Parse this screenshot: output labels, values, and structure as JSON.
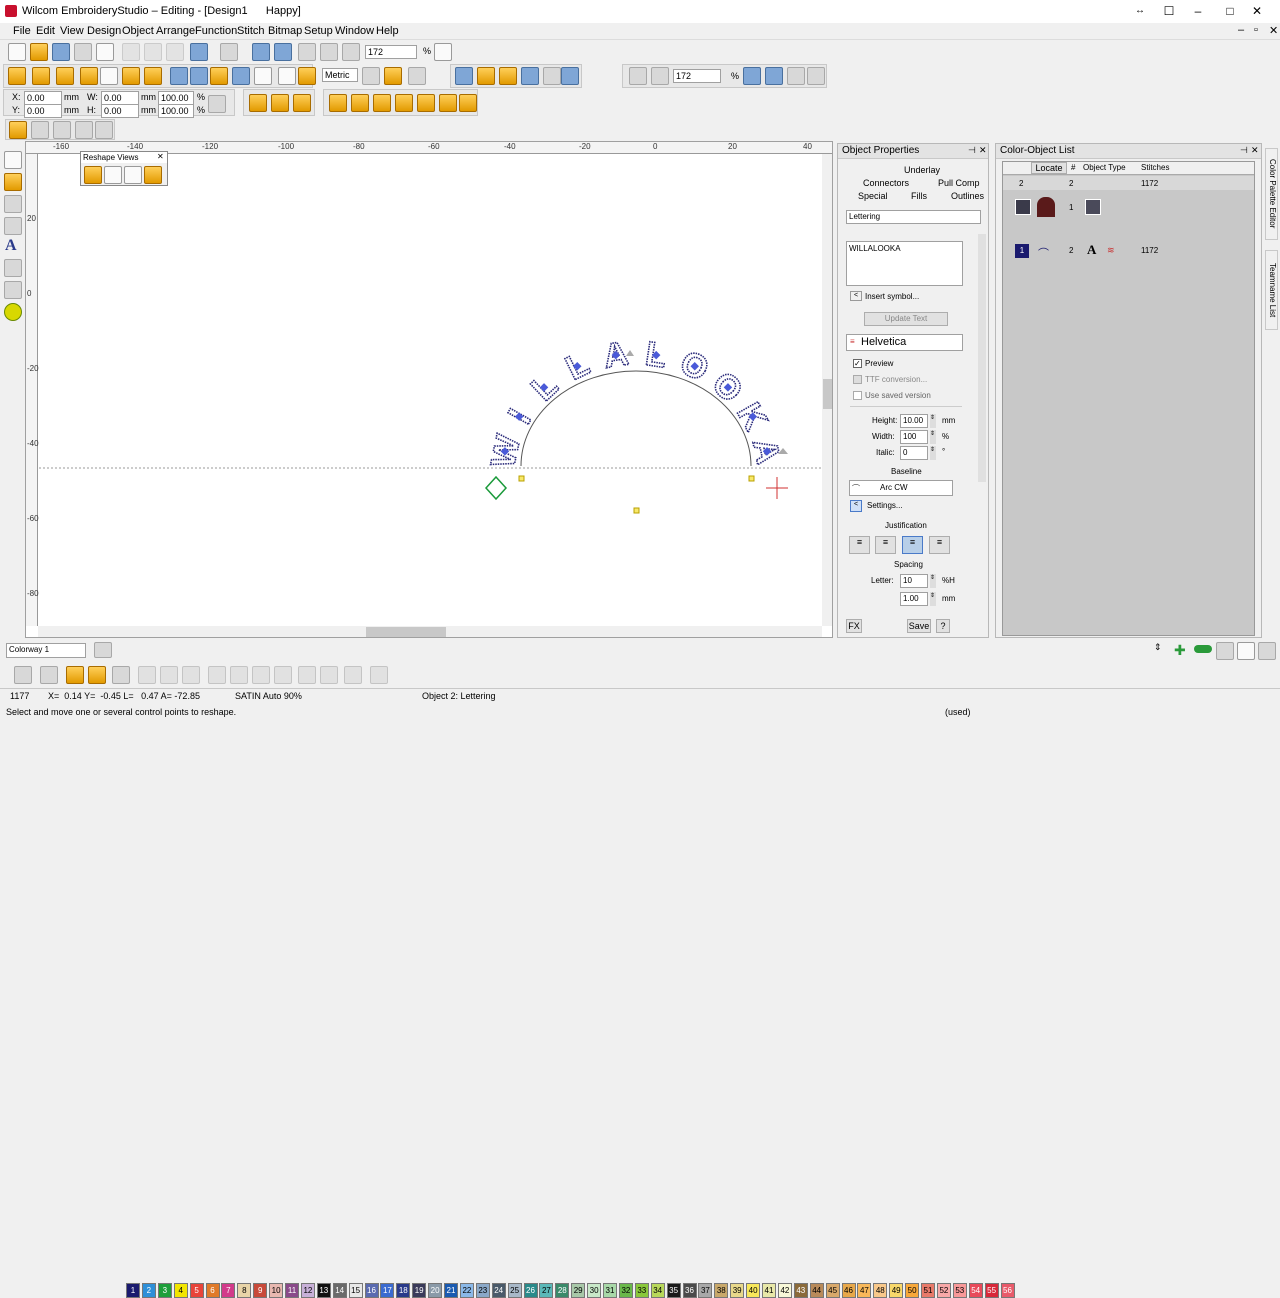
{
  "window": {
    "title": "Wilcom EmbroideryStudio – Editing - [Design1      Happy]",
    "controls": [
      "↔",
      "☐",
      "–",
      "□",
      "✕"
    ]
  },
  "menu": [
    "File",
    "Edit",
    "View",
    "Design",
    "Object",
    "Arrange",
    "Function",
    "Stitch",
    "Bitmap",
    "Setup",
    "Window",
    "Help"
  ],
  "toolbar": {
    "zoom_value": "172",
    "zoom_unit": "%",
    "units_select": "Metric",
    "zoom_value2": "172",
    "zoom_unit2": "%",
    "x_label": "X:",
    "x_value": "0.00",
    "x_unit": "mm",
    "y_label": "Y:",
    "y_value": "0.00",
    "y_unit": "mm",
    "w_label": "W:",
    "w_value": "0.00",
    "w_unit": "mm",
    "h_label": "H:",
    "h_value": "0.00",
    "h_unit": "mm",
    "w_pct": "100.00",
    "h_pct": "100.00",
    "pct": "%"
  },
  "reshape_views": {
    "title": "Reshape Views"
  },
  "ruler": {
    "top": [
      "-160",
      "-140",
      "-120",
      "-100",
      "-80",
      "-60",
      "-40",
      "-20",
      "0",
      "20",
      "40"
    ],
    "left": [
      "20",
      "0",
      "-20",
      "-40",
      "-60",
      "-80"
    ]
  },
  "design": {
    "lettering": "WILLALOOKA"
  },
  "object_properties": {
    "title": "Object Properties",
    "tabs": [
      "Underlay",
      "Connectors",
      "Pull Comp",
      "Special",
      "Fills",
      "Outlines"
    ],
    "type_select": "Lettering",
    "text_value": "WILLALOOKA",
    "insert_symbol": "Insert symbol...",
    "update_text": "Update Text",
    "font": "Helvetica",
    "preview": "Preview",
    "ttf_conversion": "TTF conversion...",
    "use_saved": "Use saved version",
    "height_label": "Height:",
    "height_value": "10.00",
    "height_unit": "mm",
    "width_label": "Width:",
    "width_value": "100",
    "width_unit": "%",
    "italic_label": "Italic:",
    "italic_value": "0",
    "italic_unit": "°",
    "baseline_label": "Baseline",
    "baseline_value": "Arc CW",
    "settings": "Settings...",
    "justification_label": "Justification",
    "spacing_label": "Spacing",
    "letter_label": "Letter:",
    "letter_value": "10",
    "letter_unit": "%H",
    "spacing_value2": "1.00",
    "spacing_unit2": "mm",
    "fx": "FX",
    "save": "Save",
    "help": "?"
  },
  "color_object_list": {
    "title": "Color-Object List",
    "locate": "Locate",
    "columns": [
      "#",
      "Object Type",
      "Stitches"
    ],
    "summary": [
      "2",
      "2",
      "1172"
    ],
    "rows": [
      {
        "num": "1",
        "stitches": ""
      },
      {
        "swatch": "1",
        "num": "2",
        "stitches": "1172"
      }
    ]
  },
  "side_tabs": [
    "Color Palette Editor",
    "Teamname List"
  ],
  "colorway": "Colorway 1",
  "palette": [
    {
      "n": "1",
      "c": "#1a1a6e",
      "t": "#fff"
    },
    {
      "n": "2",
      "c": "#2e8fd8",
      "t": "#fff"
    },
    {
      "n": "3",
      "c": "#1e9f3a",
      "t": "#fff"
    },
    {
      "n": "4",
      "c": "#f2e500",
      "t": "#000"
    },
    {
      "n": "5",
      "c": "#e8443a",
      "t": "#fff"
    },
    {
      "n": "6",
      "c": "#e07a2a",
      "t": "#fff"
    },
    {
      "n": "7",
      "c": "#d23a8a",
      "t": "#fff"
    },
    {
      "n": "8",
      "c": "#e8d4a8",
      "t": "#000"
    },
    {
      "n": "9",
      "c": "#c84a3a",
      "t": "#fff"
    },
    {
      "n": "10",
      "c": "#e8b8b0",
      "t": "#000"
    },
    {
      "n": "11",
      "c": "#8a4a8a",
      "t": "#fff"
    },
    {
      "n": "12",
      "c": "#c8b0d8",
      "t": "#000"
    },
    {
      "n": "13",
      "c": "#111111",
      "t": "#fff"
    },
    {
      "n": "14",
      "c": "#6a6a6a",
      "t": "#fff"
    },
    {
      "n": "15",
      "c": "#e8e8e8",
      "t": "#000"
    },
    {
      "n": "16",
      "c": "#5a6ab0",
      "t": "#fff"
    },
    {
      "n": "17",
      "c": "#3a6ad0",
      "t": "#fff"
    },
    {
      "n": "18",
      "c": "#2a3a8a",
      "t": "#fff"
    },
    {
      "n": "19",
      "c": "#3a3a5a",
      "t": "#fff"
    },
    {
      "n": "20",
      "c": "#8a9aa8",
      "t": "#fff"
    },
    {
      "n": "21",
      "c": "#1a5ab0",
      "t": "#fff"
    },
    {
      "n": "22",
      "c": "#8ab8e8",
      "t": "#000"
    },
    {
      "n": "23",
      "c": "#8aa8c8",
      "t": "#000"
    },
    {
      "n": "24",
      "c": "#4a5a6a",
      "t": "#fff"
    },
    {
      "n": "25",
      "c": "#a8b8c8",
      "t": "#000"
    },
    {
      "n": "26",
      "c": "#2a8a8a",
      "t": "#fff"
    },
    {
      "n": "27",
      "c": "#5ab8b8",
      "t": "#000"
    },
    {
      "n": "28",
      "c": "#3a8a6a",
      "t": "#fff"
    },
    {
      "n": "29",
      "c": "#a8c8a8",
      "t": "#000"
    },
    {
      "n": "30",
      "c": "#c8e8c8",
      "t": "#000"
    },
    {
      "n": "31",
      "c": "#a8d8a8",
      "t": "#000"
    },
    {
      "n": "32",
      "c": "#6ab84a",
      "t": "#000"
    },
    {
      "n": "33",
      "c": "#8ac83a",
      "t": "#000"
    },
    {
      "n": "34",
      "c": "#b8d85a",
      "t": "#000"
    },
    {
      "n": "35",
      "c": "#1a1a1a",
      "t": "#fff"
    },
    {
      "n": "36",
      "c": "#4a4a4a",
      "t": "#fff"
    },
    {
      "n": "37",
      "c": "#a8a8a8",
      "t": "#000"
    },
    {
      "n": "38",
      "c": "#c8a86a",
      "t": "#000"
    },
    {
      "n": "39",
      "c": "#e8d88a",
      "t": "#000"
    },
    {
      "n": "40",
      "c": "#f8e85a",
      "t": "#000"
    },
    {
      "n": "41",
      "c": "#e8e8a8",
      "t": "#000"
    },
    {
      "n": "42",
      "c": "#f8f8d8",
      "t": "#000"
    },
    {
      "n": "43",
      "c": "#8a6a3a",
      "t": "#fff"
    },
    {
      "n": "44",
      "c": "#b88a5a",
      "t": "#000"
    },
    {
      "n": "45",
      "c": "#d8a86a",
      "t": "#000"
    },
    {
      "n": "46",
      "c": "#e8a84a",
      "t": "#000"
    },
    {
      "n": "47",
      "c": "#f8b85a",
      "t": "#000"
    },
    {
      "n": "48",
      "c": "#f8c88a",
      "t": "#000"
    },
    {
      "n": "49",
      "c": "#f8d86a",
      "t": "#000"
    },
    {
      "n": "50",
      "c": "#f8a83a",
      "t": "#000"
    },
    {
      "n": "51",
      "c": "#e87a6a",
      "t": "#000"
    },
    {
      "n": "52",
      "c": "#f8a8a8",
      "t": "#000"
    },
    {
      "n": "53",
      "c": "#f89898",
      "t": "#000"
    },
    {
      "n": "54",
      "c": "#e84a5a",
      "t": "#fff"
    },
    {
      "n": "55",
      "c": "#d8283a",
      "t": "#fff"
    },
    {
      "n": "56",
      "c": "#e85a6a",
      "t": "#fff"
    }
  ],
  "status": {
    "stitches": "1177",
    "coords": "X=  0.14 Y=  -0.45 L=   0.47 A= -72.85",
    "stitch_type": "SATIN Auto 90%",
    "object": "Object 2: Lettering",
    "hint": "Select and move one or several control points to reshape.",
    "used": "(used)"
  },
  "colors": {
    "accent_orange": "#f0a000",
    "stitch_navy": "#2a2a7a",
    "selection_blue": "#4a5ad8"
  }
}
